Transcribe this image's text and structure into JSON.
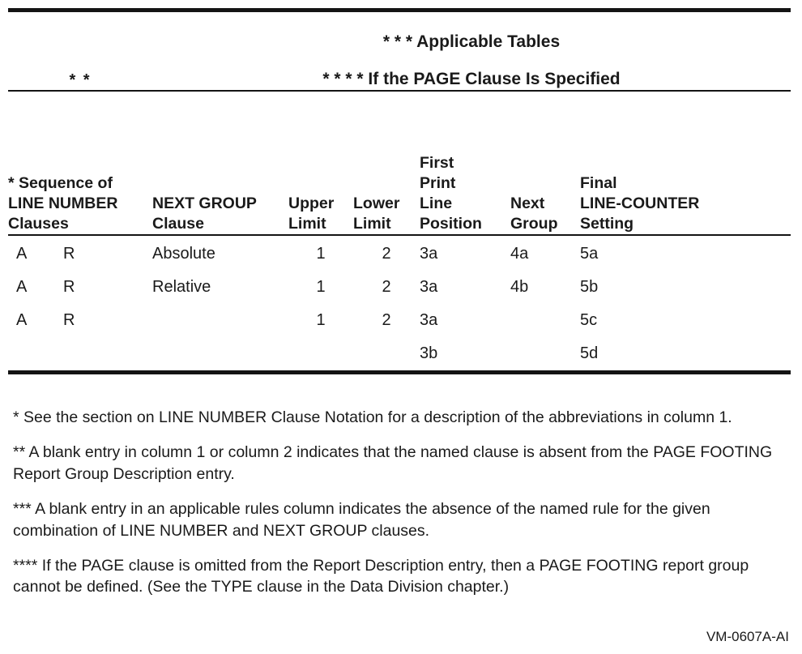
{
  "table": {
    "banner": {
      "left_marker": "* *",
      "right_line1": "* * * Applicable Tables",
      "right_line2": "* * * * If the PAGE Clause Is Specified"
    },
    "headers": {
      "col1": [
        "* Sequence of",
        "LINE NUMBER",
        "Clauses"
      ],
      "col2": [
        "NEXT GROUP",
        "Clause"
      ],
      "col3": [
        "Upper",
        "Limit"
      ],
      "col4": [
        "Lower",
        "Limit"
      ],
      "col5": [
        "First",
        "Print",
        "Line",
        "Position"
      ],
      "col6": [
        "Next",
        "Group"
      ],
      "col7": [
        "Final",
        "LINE-COUNTER",
        "Setting"
      ]
    },
    "rows": [
      {
        "sequence_a": "A",
        "sequence_r": "R",
        "next_group_clause": "Absolute",
        "upper_limit": "1",
        "lower_limit": "2",
        "first_print_line_position": "3a",
        "next_group": "4a",
        "final_line_counter_setting": "5a"
      },
      {
        "sequence_a": "A",
        "sequence_r": "R",
        "next_group_clause": "Relative",
        "upper_limit": "1",
        "lower_limit": "2",
        "first_print_line_position": "3a",
        "next_group": "4b",
        "final_line_counter_setting": "5b"
      },
      {
        "sequence_a": "A",
        "sequence_r": "R",
        "next_group_clause": "",
        "upper_limit": "1",
        "lower_limit": "2",
        "first_print_line_position": "3a",
        "next_group": "",
        "final_line_counter_setting": "5c"
      },
      {
        "sequence_a": "",
        "sequence_r": "",
        "next_group_clause": "",
        "upper_limit": "",
        "lower_limit": "",
        "first_print_line_position": "3b",
        "next_group": "",
        "final_line_counter_setting": "5d"
      }
    ]
  },
  "notes": [
    "* See the section on LINE NUMBER Clause Notation for a description of the abbreviations in column 1.",
    "** A blank entry in column 1 or column 2 indicates that the named clause is absent from the PAGE FOOTING Report Group Description entry.",
    "*** A blank entry in an applicable rules column indicates the absence of the named rule for the given combination of LINE NUMBER and NEXT GROUP clauses.",
    "**** If the PAGE clause is omitted from the Report Description entry, then a PAGE FOOTING report group cannot be defined.  (See the TYPE clause in the Data Division chapter.)"
  ],
  "figure_id": "VM-0607A-AI"
}
